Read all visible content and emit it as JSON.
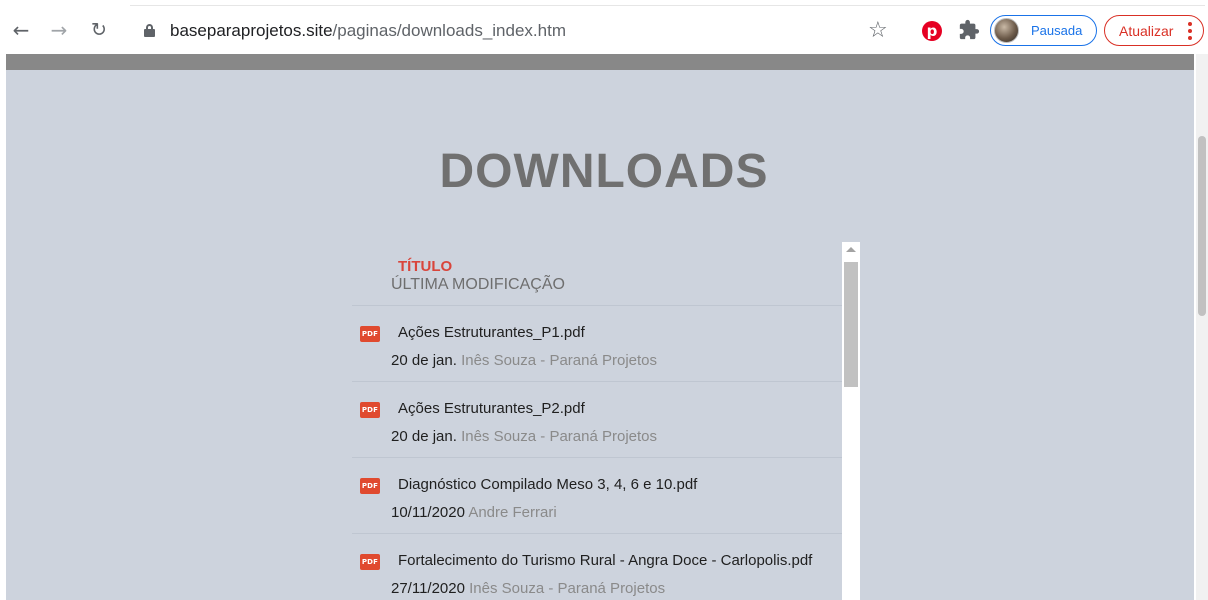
{
  "browser": {
    "address": {
      "domain": "baseparaprojetos.site",
      "path": "/paginas/downloads_index.htm"
    },
    "icons": {
      "back": "arrow-left-icon",
      "forward": "arrow-right-icon",
      "reload": "reload-icon",
      "lock": "lock-icon",
      "bookmark": "star-icon",
      "pinterest": "pinterest-icon",
      "extensions": "puzzle-icon",
      "menu": "more-vert-icon"
    },
    "profile_label": "Pausada",
    "update_label": "Atualizar"
  },
  "page": {
    "title": "DOWNLOADS",
    "columns": {
      "title": "TÍTULO",
      "modified": "ÚLTIMA MODIFICAÇÃO"
    },
    "files": [
      {
        "name": "Ações Estruturantes_P1.pdf",
        "date": "20 de jan.",
        "author": "Inês Souza - Paraná Projetos",
        "type": "PDF"
      },
      {
        "name": "Ações Estruturantes_P2.pdf",
        "date": "20 de jan.",
        "author": "Inês Souza - Paraná Projetos",
        "type": "PDF"
      },
      {
        "name": "Diagnóstico Compilado Meso 3, 4, 6 e 10.pdf",
        "date": "10/11/2020",
        "author": "Andre Ferrari",
        "type": "PDF"
      },
      {
        "name": "Fortalecimento do Turismo Rural - Angra Doce - Carlopolis.pdf",
        "date": "27/11/2020",
        "author": "Inês Souza - Paraná Projetos",
        "type": "PDF"
      }
    ]
  },
  "colors": {
    "page_background": "#cdd3dd",
    "header_bar": "#888888",
    "title": "#707070",
    "column_title_accent": "#d9453b",
    "author_text": "#8a8a8a",
    "pdf_icon": "#e04a2f",
    "profile_accent": "#1a73e8",
    "update_accent": "#d93025"
  }
}
